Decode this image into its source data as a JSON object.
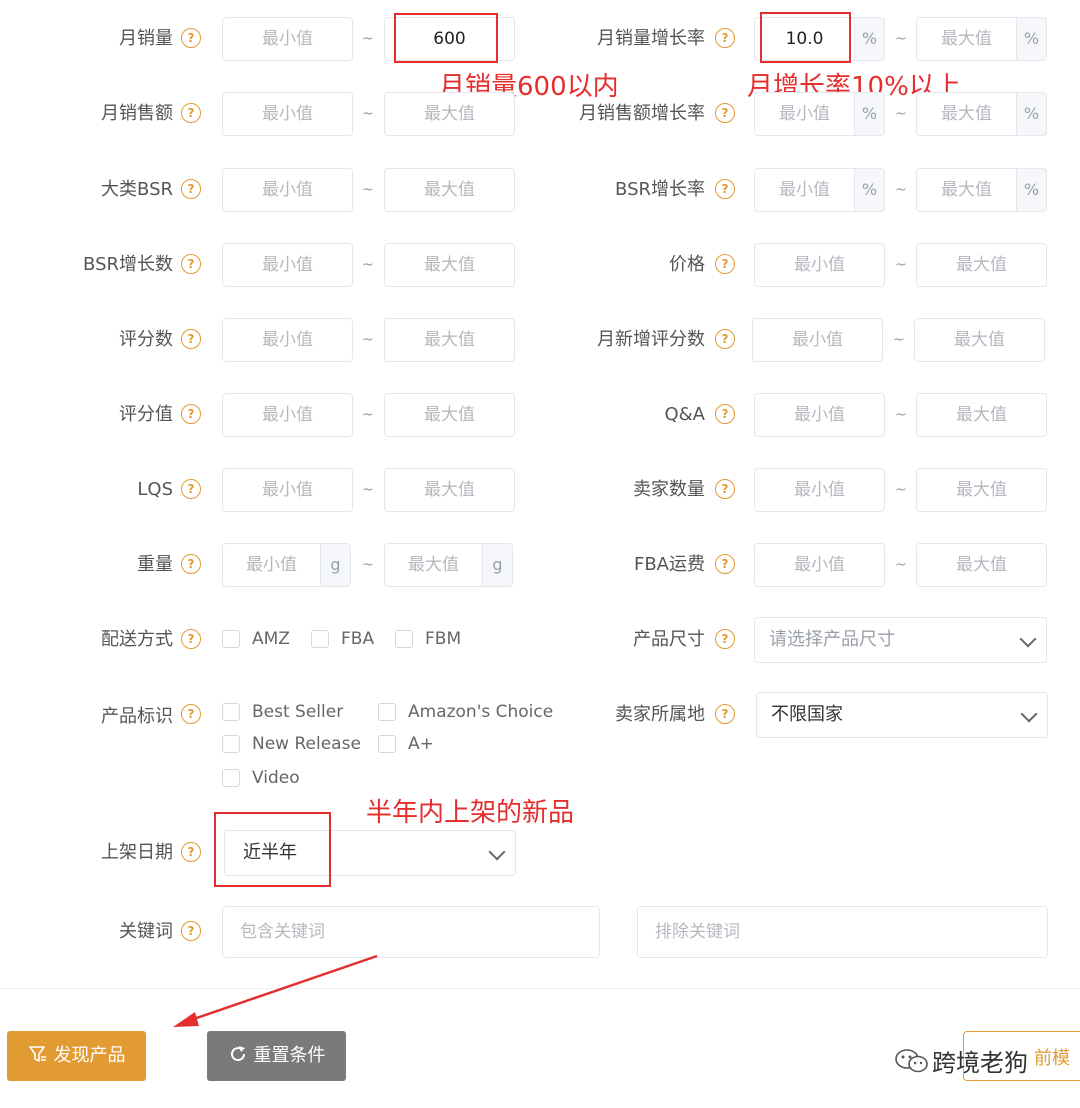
{
  "placeholders": {
    "min": "最小值",
    "max": "最大值",
    "tilde": "~",
    "pct": "%",
    "g": "g"
  },
  "rows": {
    "monthly_sales": {
      "label": "月销量",
      "max_value": "600"
    },
    "monthly_sales_growth": {
      "label": "月销量增长率",
      "min_value": "10.0"
    },
    "monthly_revenue": {
      "label": "月销售额"
    },
    "monthly_revenue_growth": {
      "label": "月销售额增长率"
    },
    "category_bsr": {
      "label": "大类BSR"
    },
    "bsr_growth_rate": {
      "label": "BSR增长率"
    },
    "bsr_growth_count": {
      "label": "BSR增长数"
    },
    "price": {
      "label": "价格"
    },
    "rating_count": {
      "label": "评分数"
    },
    "monthly_new_ratings": {
      "label": "月新增评分数"
    },
    "rating_value": {
      "label": "评分值"
    },
    "qa": {
      "label": "Q&A"
    },
    "lqs": {
      "label": "LQS"
    },
    "seller_count": {
      "label": "卖家数量"
    },
    "weight": {
      "label": "重量"
    },
    "fba_fee": {
      "label": "FBA运费"
    },
    "delivery": {
      "label": "配送方式",
      "options": [
        "AMZ",
        "FBA",
        "FBM"
      ]
    },
    "product_size": {
      "label": "产品尺寸",
      "placeholder": "请选择产品尺寸"
    },
    "product_badge": {
      "label": "产品标识",
      "options": [
        "Best Seller",
        "Amazon's Choice",
        "New Release",
        "A+",
        "Video"
      ]
    },
    "seller_location": {
      "label": "卖家所属地",
      "value": "不限国家"
    },
    "listing_date": {
      "label": "上架日期",
      "value": "近半年"
    },
    "keyword": {
      "label": "关键词",
      "include_placeholder": "包含关键词",
      "exclude_placeholder": "排除关键词"
    }
  },
  "annotations": {
    "sales": "月销量600以内",
    "growth": "月增长率10%以上",
    "new": "半年内上架的新品"
  },
  "buttons": {
    "discover": "发现产品",
    "reset": "重置条件",
    "template_partial": "前模"
  },
  "watermark": "跨境老狗",
  "colors": {
    "accent": "#e29a33",
    "annotation": "#e52e2e",
    "reset_bg": "#7a7a7a"
  }
}
